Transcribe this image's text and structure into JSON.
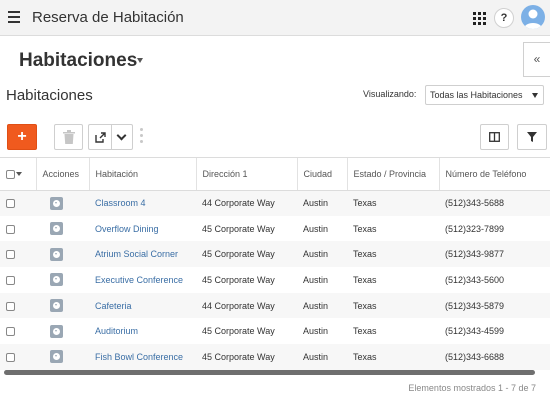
{
  "app": {
    "title": "Reserva de Habitación"
  },
  "header": {
    "page_title": "Habitaciones",
    "collapse_label": "«",
    "help_label": "?"
  },
  "list": {
    "title": "Habitaciones",
    "view_label": "Visualizando:",
    "view_value": "Todas las Habitaciones"
  },
  "toolbar": {
    "add_label": "+"
  },
  "table": {
    "columns": [
      "Acciones",
      "Habitación",
      "Dirección 1",
      "Ciudad",
      "Estado / Provincia",
      "Número de Teléfono"
    ],
    "rows": [
      {
        "room": "Classroom 4",
        "address": "44 Corporate Way",
        "city": "Austin",
        "state": "Texas",
        "phone": "(512)343-5688"
      },
      {
        "room": "Overflow Dining",
        "address": "45 Corporate Way",
        "city": "Austin",
        "state": "Texas",
        "phone": "(512)323-7899"
      },
      {
        "room": "Atrium Social Corner",
        "address": "45 Corporate Way",
        "city": "Austin",
        "state": "Texas",
        "phone": "(512)343-9877"
      },
      {
        "room": "Executive Conference",
        "address": "45 Corporate Way",
        "city": "Austin",
        "state": "Texas",
        "phone": "(512)343-5600"
      },
      {
        "room": "Cafeteria",
        "address": "44 Corporate Way",
        "city": "Austin",
        "state": "Texas",
        "phone": "(512)343-5879"
      },
      {
        "room": "Auditorium",
        "address": "45 Corporate Way",
        "city": "Austin",
        "state": "Texas",
        "phone": "(512)343-4599"
      },
      {
        "room": "Fish Bowl Conference",
        "address": "45 Corporate Way",
        "city": "Austin",
        "state": "Texas",
        "phone": "(512)343-6688"
      }
    ]
  },
  "footer": {
    "items_shown": "Elementos mostrados 1 - 7 de 7"
  },
  "colors": {
    "accent": "#f05a1e",
    "link": "#3a6ea5",
    "action_icon": "#9aa7b4"
  },
  "icons": {
    "menu": "hamburger-icon",
    "apps": "grid-icon",
    "user": "avatar-icon",
    "delete": "trash-icon",
    "export": "export-icon",
    "columns": "columns-icon",
    "filter": "filter-icon",
    "row_action": "chevron-circle-icon"
  }
}
